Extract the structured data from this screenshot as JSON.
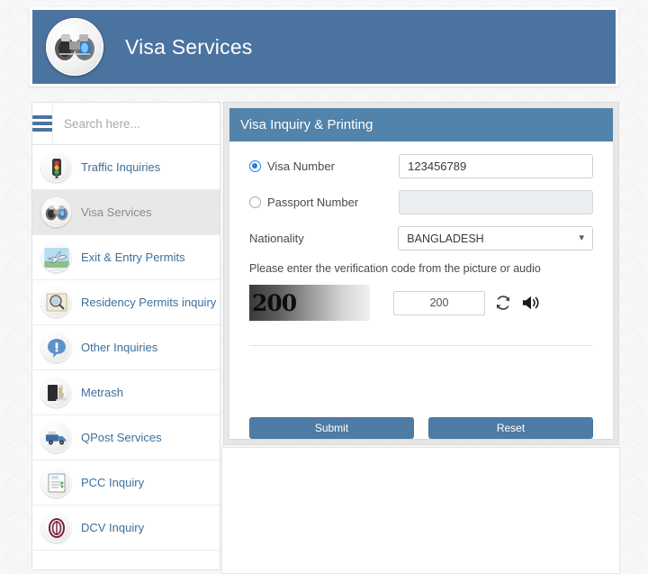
{
  "header": {
    "title": "Visa Services",
    "icon": "binoculars-icon"
  },
  "sidebar": {
    "menu_icon": "hamburger-icon",
    "search": {
      "placeholder": "Search here...",
      "value": ""
    },
    "items": [
      {
        "label": "Traffic Inquiries",
        "icon": "traffic-light-icon",
        "active": false
      },
      {
        "label": "Visa Services",
        "icon": "binoculars-icon",
        "active": true
      },
      {
        "label": "Exit & Entry Permits",
        "icon": "airplane-icon",
        "active": false
      },
      {
        "label": "Residency Permits inquiry",
        "icon": "magnifier-document-icon",
        "active": false
      },
      {
        "label": "Other Inquiries",
        "icon": "exclamation-bubble-icon",
        "active": false
      },
      {
        "label": "Metrash",
        "icon": "metrash-icon",
        "active": false
      },
      {
        "label": "QPost Services",
        "icon": "delivery-truck-icon",
        "active": false
      },
      {
        "label": "PCC Inquiry",
        "icon": "certificate-icon",
        "active": false
      },
      {
        "label": "DCV Inquiry",
        "icon": "dcv-logo-icon",
        "active": false
      }
    ]
  },
  "panel": {
    "title": "Visa Inquiry & Printing",
    "visa_number": {
      "radio_label": "Visa Number",
      "selected": true,
      "value": "123456789"
    },
    "passport_number": {
      "radio_label": "Passport Number",
      "selected": false,
      "value": ""
    },
    "nationality": {
      "label": "Nationality",
      "selected": "BANGLADESH",
      "chevron": "chevron-down-icon"
    },
    "verification": {
      "instruction": "Please enter the verification code from the picture or audio",
      "captcha_text": "200",
      "input_value": "200",
      "refresh_icon": "refresh-icon",
      "audio_icon": "speaker-icon"
    },
    "buttons": {
      "submit": "Submit",
      "reset": "Reset"
    }
  },
  "colors": {
    "header_blue": "#4b73a0",
    "panel_header_blue": "#5183ab",
    "button_blue": "#4e7ca5",
    "link_blue": "#3d6f9c",
    "radio_accent": "#1f7fe0"
  }
}
